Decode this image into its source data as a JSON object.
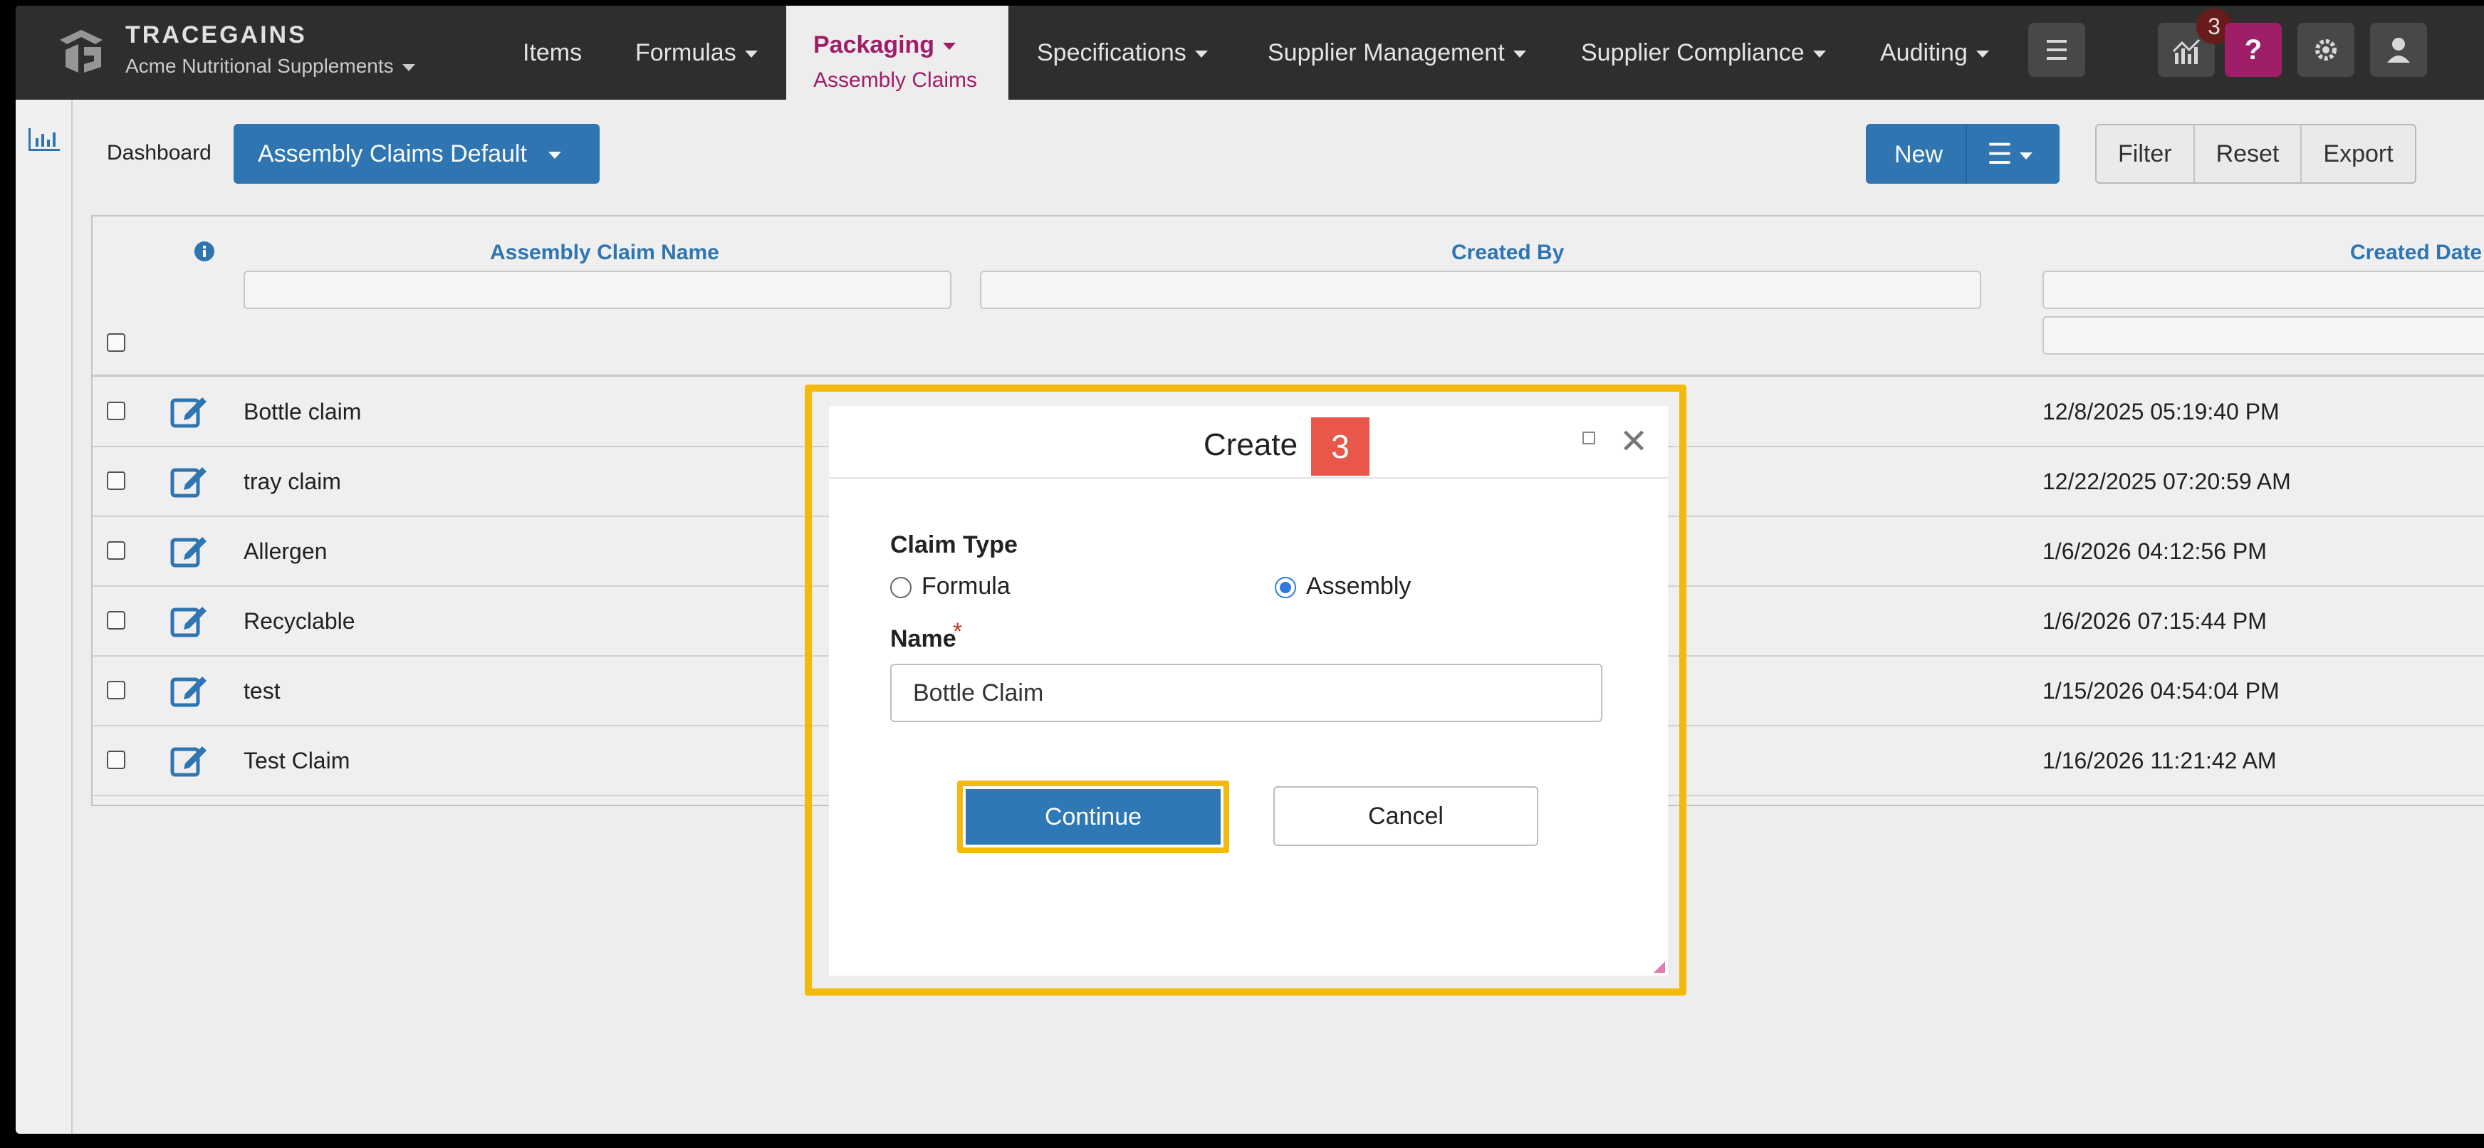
{
  "header": {
    "brand": "TRACEGAINS",
    "org": "Acme Nutritional Supplements",
    "menus": {
      "items": "Items",
      "formulas": "Formulas",
      "packaging": "Packaging",
      "packaging_sub": "Assembly Claims",
      "specifications": "Specifications",
      "supplier_management": "Supplier Management",
      "supplier_compliance": "Supplier Compliance",
      "auditing": "Auditing"
    },
    "notification_count": "3",
    "help_glyph": "?"
  },
  "toolbar": {
    "dashboard": "Dashboard",
    "view": "Assembly Claims Default",
    "new": "New",
    "filter": "Filter",
    "reset": "Reset",
    "export": "Export"
  },
  "grid": {
    "columns": {
      "name": "Assembly Claim Name",
      "created_by": "Created By",
      "created_date": "Created Date"
    },
    "rows": [
      {
        "name": "Bottle claim",
        "created": "12/8/2025 05:19:40 PM"
      },
      {
        "name": "tray claim",
        "created": "12/22/2025 07:20:59 AM"
      },
      {
        "name": "Allergen",
        "created": "1/6/2026 04:12:56 PM"
      },
      {
        "name": "Recyclable",
        "created": "1/6/2026 07:15:44 PM"
      },
      {
        "name": "test",
        "created": "1/15/2026 04:54:04 PM"
      },
      {
        "name": "Test Claim",
        "created": "1/16/2026 11:21:42 AM"
      }
    ]
  },
  "dialog": {
    "title": "Create",
    "step": "3",
    "claim_type_label": "Claim Type",
    "option_formula": "Formula",
    "option_assembly": "Assembly",
    "selected": "Assembly",
    "name_label": "Name",
    "required_mark": "*",
    "name_value": "Bottle Claim",
    "continue": "Continue",
    "cancel": "Cancel"
  },
  "colors": {
    "nav_bg": "#2f2f2f",
    "accent_blue": "#2f78b6",
    "active_menu": "#a2206b",
    "highlight": "#f3b90c",
    "step_badge": "#e9574b"
  }
}
